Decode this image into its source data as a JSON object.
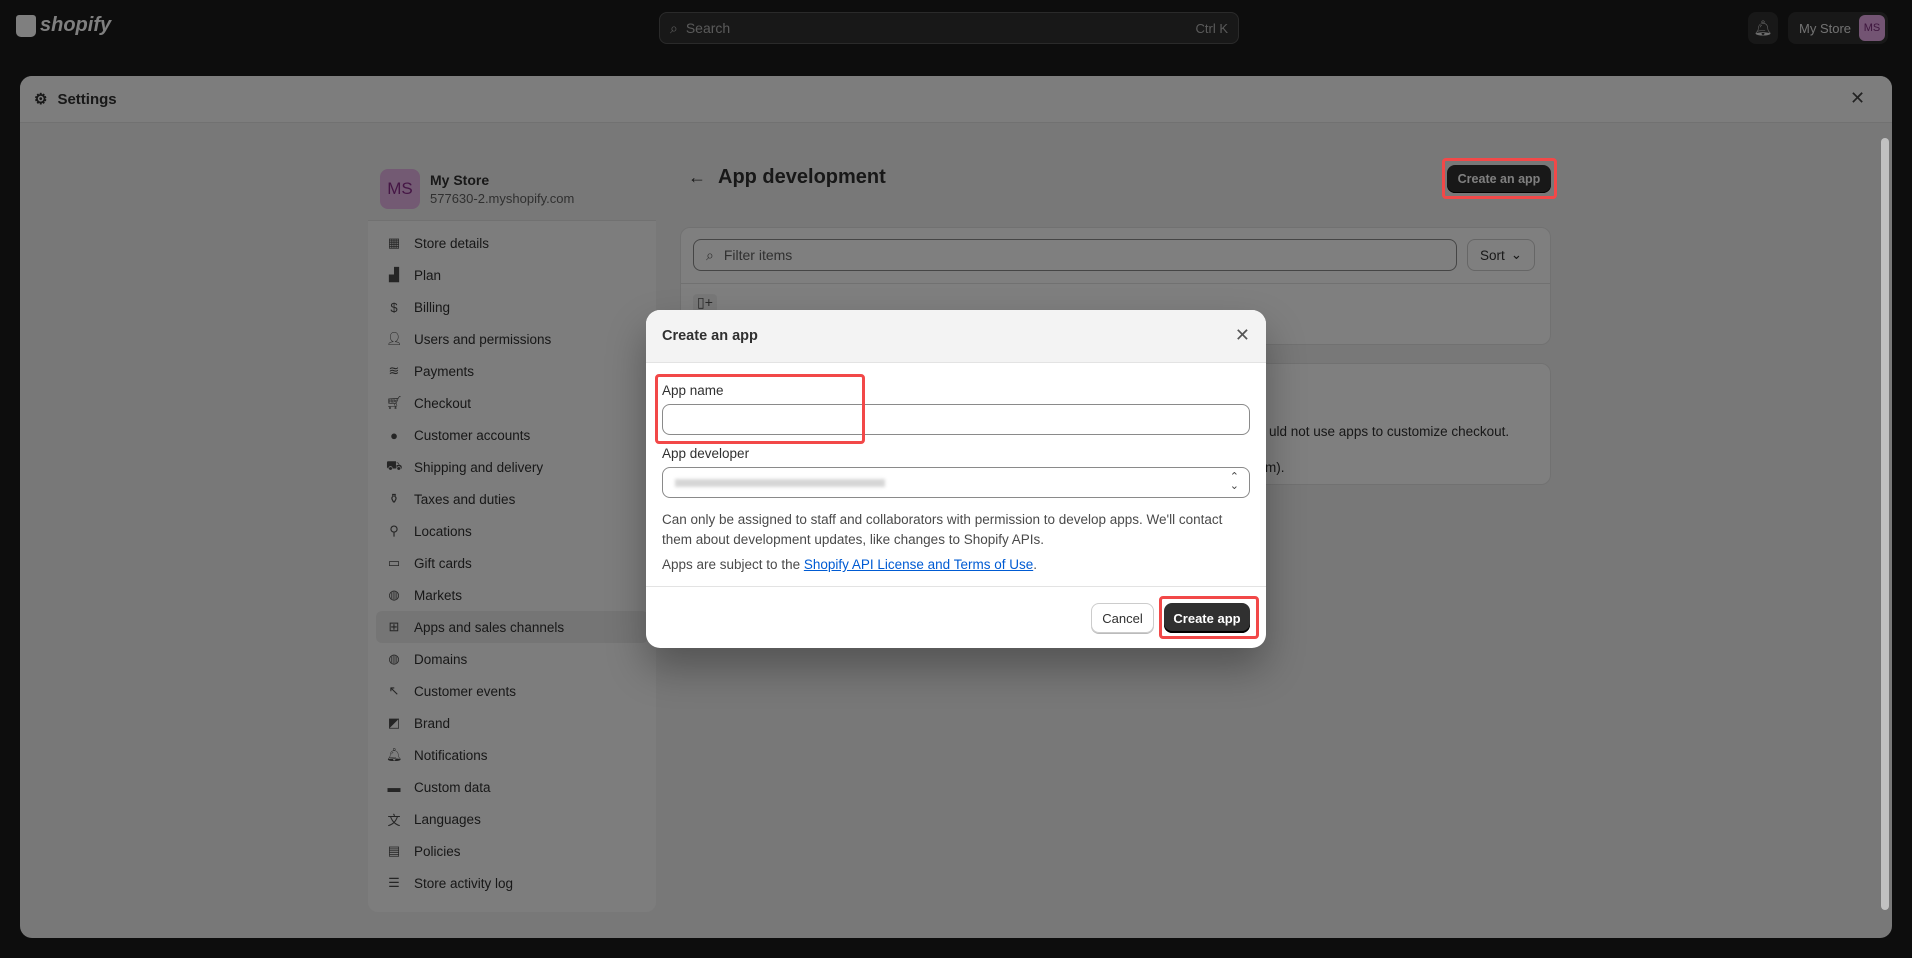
{
  "topbar": {
    "logo": "shopify",
    "search_placeholder": "Search",
    "search_shortcut": "Ctrl K",
    "store_label": "My Store",
    "avatar_initials": "MS"
  },
  "settings": {
    "title": "Settings"
  },
  "sidebar": {
    "store_name": "My Store",
    "store_domain": "577630-2.myshopify.com",
    "avatar_initials": "MS",
    "items": [
      {
        "label": "Store details",
        "icon": "store-icon"
      },
      {
        "label": "Plan",
        "icon": "plan-icon"
      },
      {
        "label": "Billing",
        "icon": "billing-icon"
      },
      {
        "label": "Users and permissions",
        "icon": "users-icon"
      },
      {
        "label": "Payments",
        "icon": "payments-icon"
      },
      {
        "label": "Checkout",
        "icon": "cart-icon"
      },
      {
        "label": "Customer accounts",
        "icon": "person-icon"
      },
      {
        "label": "Shipping and delivery",
        "icon": "truck-icon"
      },
      {
        "label": "Taxes and duties",
        "icon": "tax-icon"
      },
      {
        "label": "Locations",
        "icon": "location-icon"
      },
      {
        "label": "Gift cards",
        "icon": "gift-card-icon"
      },
      {
        "label": "Markets",
        "icon": "globe-icon"
      },
      {
        "label": "Apps and sales channels",
        "icon": "apps-icon",
        "active": true
      },
      {
        "label": "Domains",
        "icon": "globe-icon"
      },
      {
        "label": "Customer events",
        "icon": "cursor-icon"
      },
      {
        "label": "Brand",
        "icon": "brand-icon"
      },
      {
        "label": "Notifications",
        "icon": "bell-icon"
      },
      {
        "label": "Custom data",
        "icon": "data-icon"
      },
      {
        "label": "Languages",
        "icon": "language-icon"
      },
      {
        "label": "Policies",
        "icon": "policy-icon"
      },
      {
        "label": "Store activity log",
        "icon": "list-icon"
      }
    ]
  },
  "main": {
    "title": "App development",
    "create_button": "Create an app",
    "filter_placeholder": "Filter items",
    "sort_label": "Sort",
    "hidden_fragment_1": "uld not use apps to customize checkout.",
    "hidden_fragment_2": "m)."
  },
  "modal": {
    "title": "Create an app",
    "app_name_label": "App name",
    "app_name_value": "",
    "app_developer_label": "App developer",
    "help_text": "Can only be assigned to staff and collaborators with permission to develop apps. We'll contact them about development updates, like changes to Shopify APIs.",
    "terms_prefix": "Apps are subject to the ",
    "terms_link": "Shopify API License and Terms of Use",
    "terms_suffix": ".",
    "cancel_label": "Cancel",
    "create_label": "Create app"
  },
  "colors": {
    "highlight": "#f24848",
    "primary_button": "#303030",
    "link": "#005bd3"
  }
}
